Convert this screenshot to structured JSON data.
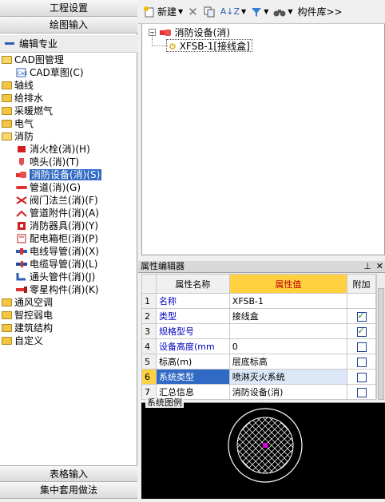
{
  "left_nav": {
    "top1": "工程设置",
    "top2": "绘图输入",
    "edit_spec": "编辑专业",
    "bottom1": "表格输入",
    "bottom2": "集中套用做法"
  },
  "tree": [
    {
      "label": "CAD图管理",
      "level": 0,
      "icon": "folder-open-icon"
    },
    {
      "label": "CAD草图(C)",
      "level": 1,
      "icon": "cad-icon"
    },
    {
      "label": "轴线",
      "level": 0,
      "icon": "folder-icon"
    },
    {
      "label": "给排水",
      "level": 0,
      "icon": "folder-icon"
    },
    {
      "label": "采暖燃气",
      "level": 0,
      "icon": "folder-icon"
    },
    {
      "label": "电气",
      "level": 0,
      "icon": "folder-icon"
    },
    {
      "label": "消防",
      "level": 0,
      "icon": "folder-open-icon"
    },
    {
      "label": "消火栓(消)(H)",
      "level": 1,
      "icon": "hydrant-icon"
    },
    {
      "label": "喷头(消)(T)",
      "level": 1,
      "icon": "sprinkler-icon"
    },
    {
      "label": "消防设备(消)(S)",
      "level": 1,
      "icon": "device-icon",
      "selected": true
    },
    {
      "label": "管道(消)(G)",
      "level": 1,
      "icon": "pipe-icon"
    },
    {
      "label": "阀门法兰(消)(F)",
      "level": 1,
      "icon": "valve-icon"
    },
    {
      "label": "管道附件(消)(A)",
      "level": 1,
      "icon": "pipe-accessory-icon"
    },
    {
      "label": "消防器具(消)(Y)",
      "level": 1,
      "icon": "fire-apparatus-icon"
    },
    {
      "label": "配电箱柜(消)(P)",
      "level": 1,
      "icon": "panel-icon"
    },
    {
      "label": "电线导管(消)(X)",
      "level": 1,
      "icon": "wire-icon"
    },
    {
      "label": "电缆导管(消)(L)",
      "level": 1,
      "icon": "cable-icon"
    },
    {
      "label": "通头管件(消)(J)",
      "level": 1,
      "icon": "fitting-icon"
    },
    {
      "label": "零星构件(消)(K)",
      "level": 1,
      "icon": "misc-icon"
    },
    {
      "label": "通风空调",
      "level": 0,
      "icon": "folder-icon"
    },
    {
      "label": "智控弱电",
      "level": 0,
      "icon": "folder-icon"
    },
    {
      "label": "建筑结构",
      "level": 0,
      "icon": "folder-icon"
    },
    {
      "label": "自定义",
      "level": 0,
      "icon": "folder-icon"
    }
  ],
  "toolbar": {
    "new_label": "新建",
    "lib_label": "构件库>>"
  },
  "rtree": {
    "parent": "消防设备(消)",
    "child": "XFSB-1[接线盒]"
  },
  "prop": {
    "title": "属性编辑器",
    "col_name": "属性名称",
    "col_value": "属性值",
    "col_add": "附加",
    "rows": [
      {
        "num": "1",
        "name": "名称",
        "value": "XFSB-1",
        "add": null,
        "blue": true
      },
      {
        "num": "2",
        "name": "类型",
        "value": "接线盒",
        "add": true,
        "blue": true
      },
      {
        "num": "3",
        "name": "规格型号",
        "value": "",
        "add": true,
        "blue": true
      },
      {
        "num": "4",
        "name": "设备高度(mm",
        "value": "0",
        "add": false,
        "blue": true
      },
      {
        "num": "5",
        "name": "标高(m)",
        "value": "层底标高",
        "add": false,
        "blue": false
      },
      {
        "num": "6",
        "name": "系统类型",
        "value": "喷淋灭火系统",
        "add": false,
        "blue": true,
        "selected": true
      },
      {
        "num": "7",
        "name": "汇总信息",
        "value": "消防设备(消)",
        "add": false,
        "blue": false
      }
    ]
  },
  "legend": {
    "title": "系统图例"
  }
}
